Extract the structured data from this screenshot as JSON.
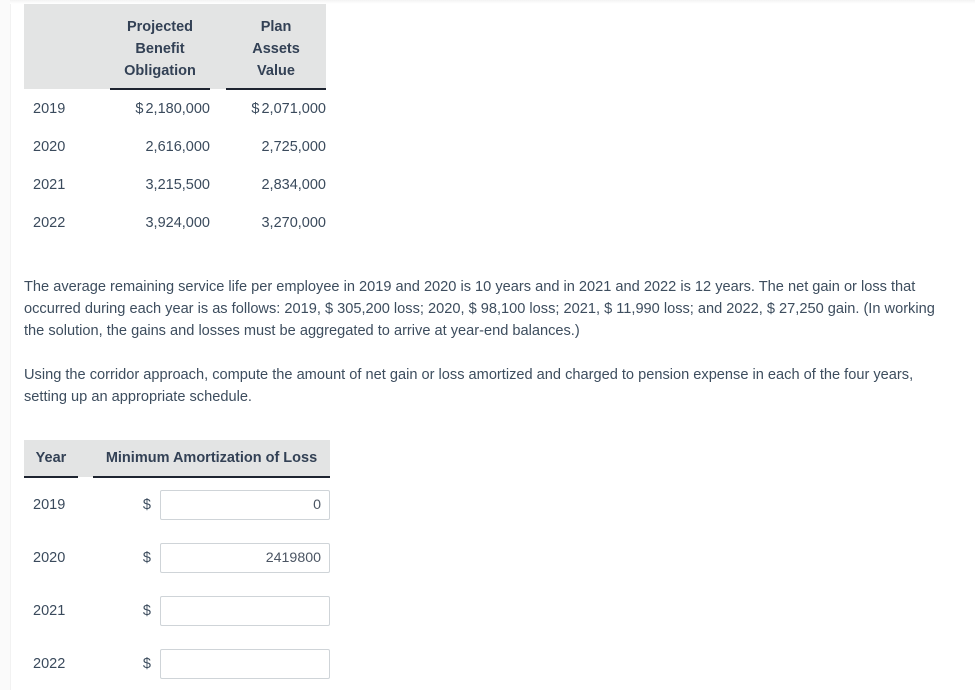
{
  "given_table": {
    "columns": [
      "",
      "Projected Benefit Obligation",
      "Plan Assets Value"
    ],
    "column_lines": [
      [
        "Projected",
        "Benefit",
        "Obligation"
      ],
      [
        "Plan",
        "Assets",
        "Value"
      ]
    ],
    "rows": [
      {
        "year": "2019",
        "pbo_currency": "$",
        "pbo": "2,180,000",
        "pav_currency": "$",
        "pav": "2,071,000"
      },
      {
        "year": "2020",
        "pbo_currency": "",
        "pbo": "2,616,000",
        "pav_currency": "",
        "pav": "2,725,000"
      },
      {
        "year": "2021",
        "pbo_currency": "",
        "pbo": "3,215,500",
        "pav_currency": "",
        "pav": "2,834,000"
      },
      {
        "year": "2022",
        "pbo_currency": "",
        "pbo": "3,924,000",
        "pav_currency": "",
        "pav": "3,270,000"
      }
    ]
  },
  "paragraphs": {
    "p1": "The average remaining service life per employee in 2019 and 2020 is 10 years and in 2021 and 2022 is 12 years. The net gain or loss that occurred during each year is as follows: 2019, $ 305,200 loss; 2020, $ 98,100 loss; 2021, $ 11,990 loss; and 2022, $ 27,250 gain. (In working the solution, the gains and losses must be aggregated to arrive at year-end balances.)",
    "p2": "Using the corridor approach, compute the amount of net gain or loss amortized and charged to pension expense in each of the four years, setting up an appropriate schedule."
  },
  "answer_table": {
    "headers": {
      "year": "Year",
      "amount": "Minimum Amortization of Loss"
    },
    "rows": [
      {
        "year": "2019",
        "currency": "$",
        "value": "0",
        "placeholder": ""
      },
      {
        "year": "2020",
        "currency": "$",
        "value": "2419800",
        "placeholder": ""
      },
      {
        "year": "2021",
        "currency": "$",
        "value": "",
        "placeholder": ""
      },
      {
        "year": "2022",
        "currency": "$",
        "value": "",
        "placeholder": ""
      }
    ]
  },
  "colors": {
    "text": "#3d4d5e",
    "header_text": "#334155",
    "header_background": "#e3e4e4",
    "rule": "#1e2430",
    "input_border": "#cfd4d8",
    "page_background": "#ffffff"
  }
}
